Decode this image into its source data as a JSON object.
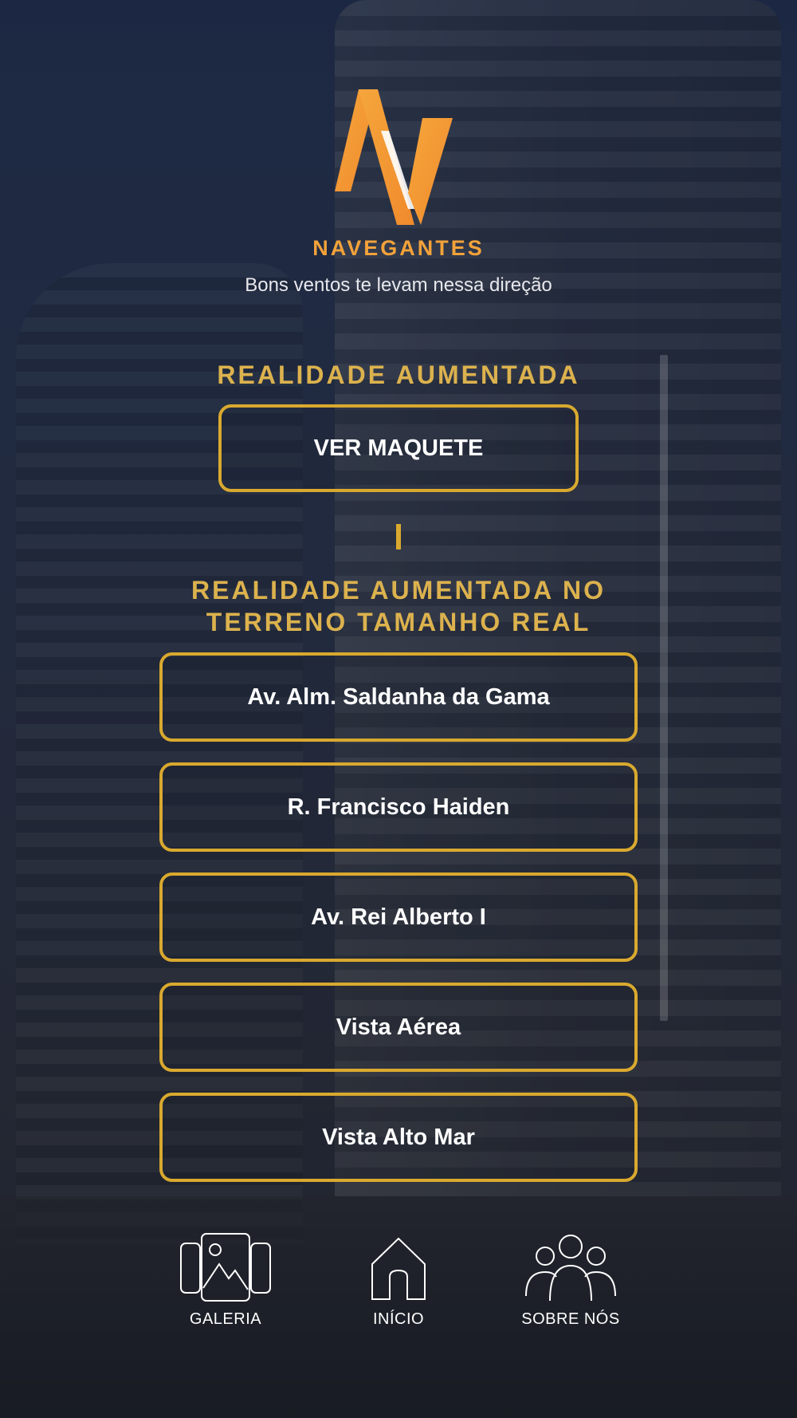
{
  "header": {
    "brand": "NAVEGANTES",
    "tagline": "Bons ventos te levam nessa direção",
    "logo_icon": "navegantes-logo-icon"
  },
  "section1": {
    "title": "REALIDADE AUMENTADA",
    "button_label": "VER MAQUETE"
  },
  "section2": {
    "title_line1": "REALIDADE AUMENTADA NO",
    "title_line2": "TERRENO TAMANHO REAL",
    "buttons": [
      {
        "label": "Av. Alm. Saldanha da Gama"
      },
      {
        "label": "R. Francisco Haiden"
      },
      {
        "label": "Av. Rei Alberto I"
      },
      {
        "label": "Vista Aérea"
      },
      {
        "label": "Vista Alto Mar"
      }
    ]
  },
  "bottom_nav": {
    "items": [
      {
        "label": "GALERIA",
        "icon": "gallery-icon"
      },
      {
        "label": "INÍCIO",
        "icon": "home-icon"
      },
      {
        "label": "SOBRE NÓS",
        "icon": "people-icon"
      }
    ]
  },
  "colors": {
    "accent_gold": "#d9a92f",
    "brand_orange": "#f3a23a",
    "text_white": "#ffffff"
  }
}
